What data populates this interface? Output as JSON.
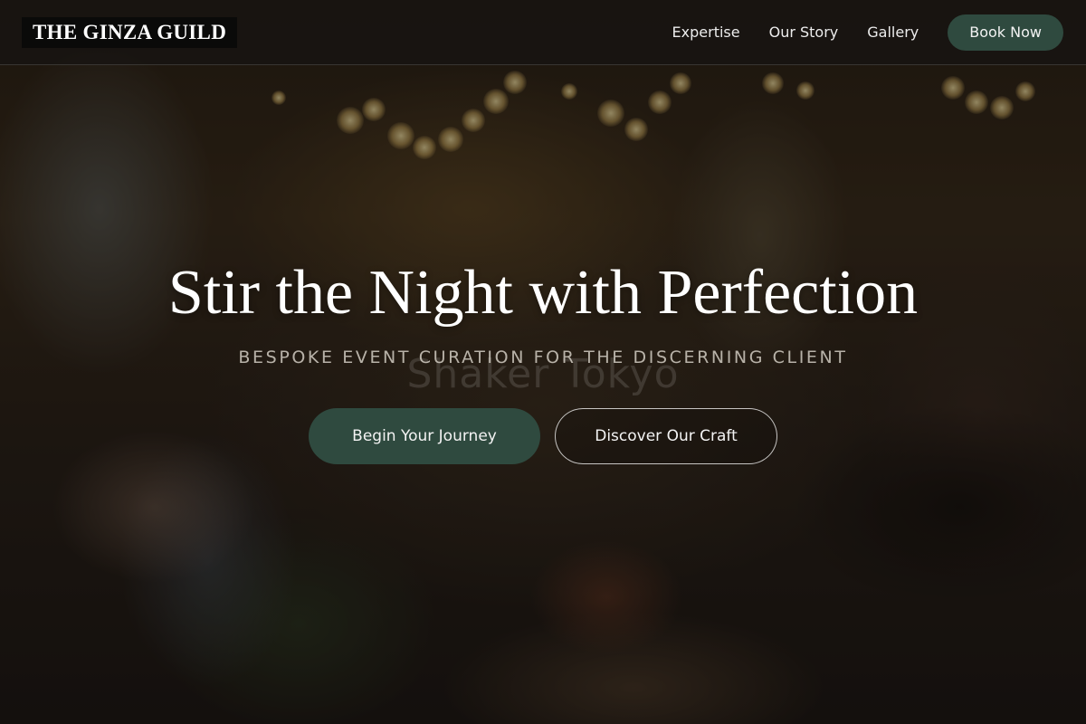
{
  "brand": {
    "name": "THE GINZA GUILD"
  },
  "nav": {
    "links": [
      {
        "label": "Expertise"
      },
      {
        "label": "Our Story"
      },
      {
        "label": "Gallery"
      }
    ],
    "cta_label": "Book Now"
  },
  "hero": {
    "title": "Stir the Night with Perfection",
    "subtitle": "BESPOKE EVENT CURATION FOR THE DISCERNING CLIENT",
    "watermark": "Shaker Tokyo",
    "primary_button": "Begin Your Journey",
    "secondary_button": "Discover Our Craft",
    "background": "celebration-toast-photo"
  },
  "colors": {
    "accent_green": "#2f4a3f",
    "nav_background": "#161412",
    "text_light": "#ffffff"
  }
}
